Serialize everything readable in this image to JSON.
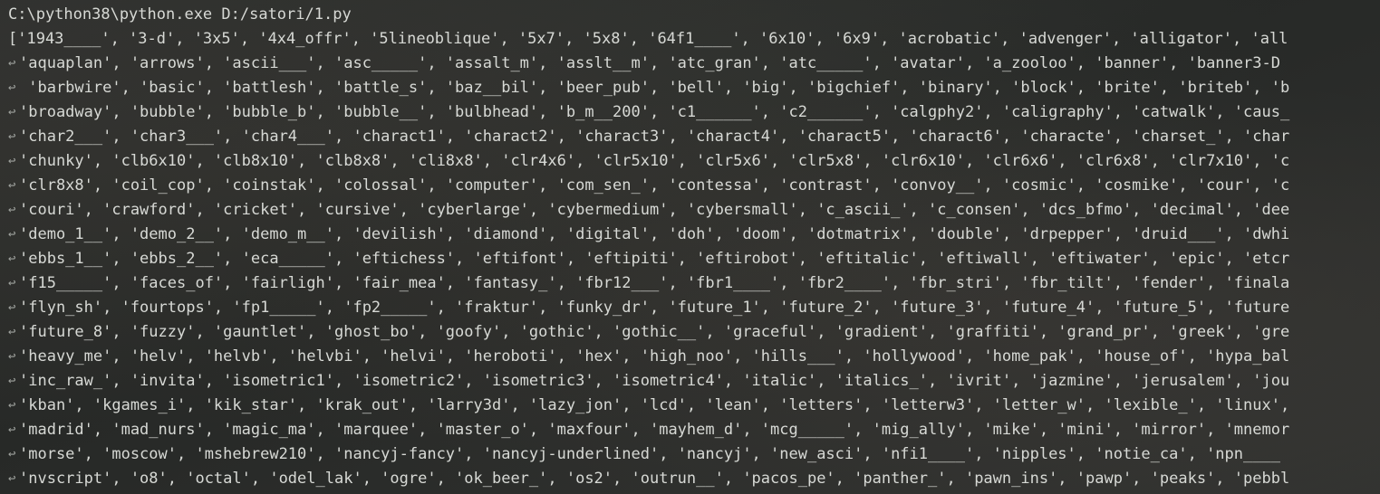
{
  "command": "C:\\python38\\python.exe D:/satori/1.py",
  "output_lines": [
    "['1943____', '3-d', '3x5', '4x4_offr', '5lineoblique', '5x7', '5x8', '64f1____', '6x10', '6x9', 'acrobatic', 'advenger', 'alligator', 'all",
    "'aquaplan', 'arrows', 'ascii___', 'asc_____', 'assalt_m', 'asslt__m', 'atc_gran', 'atc_____', 'avatar', 'a_zooloo', 'banner', 'banner3-D",
    " 'barbwire', 'basic', 'battlesh', 'battle_s', 'baz__bil', 'beer_pub', 'bell', 'big', 'bigchief', 'binary', 'block', 'brite', 'briteb', 'b",
    "'broadway', 'bubble', 'bubble_b', 'bubble__', 'bulbhead', 'b_m__200', 'c1______', 'c2______', 'calgphy2', 'caligraphy', 'catwalk', 'caus_",
    "'char2___', 'char3___', 'char4___', 'charact1', 'charact2', 'charact3', 'charact4', 'charact5', 'charact6', 'characte', 'charset_', 'char",
    "'chunky', 'clb6x10', 'clb8x10', 'clb8x8', 'cli8x8', 'clr4x6', 'clr5x10', 'clr5x6', 'clr5x8', 'clr6x10', 'clr6x6', 'clr6x8', 'clr7x10', 'c",
    "'clr8x8', 'coil_cop', 'coinstak', 'colossal', 'computer', 'com_sen_', 'contessa', 'contrast', 'convoy__', 'cosmic', 'cosmike', 'cour', 'c",
    "'couri', 'crawford', 'cricket', 'cursive', 'cyberlarge', 'cybermedium', 'cybersmall', 'c_ascii_', 'c_consen', 'dcs_bfmo', 'decimal', 'dee",
    "'demo_1__', 'demo_2__', 'demo_m__', 'devilish', 'diamond', 'digital', 'doh', 'doom', 'dotmatrix', 'double', 'drpepper', 'druid___', 'dwhi",
    "'ebbs_1__', 'ebbs_2__', 'eca_____', 'eftichess', 'eftifont', 'eftipiti', 'eftirobot', 'eftitalic', 'eftiwall', 'eftiwater', 'epic', 'etcr",
    "'f15_____', 'faces_of', 'fairligh', 'fair_mea', 'fantasy_', 'fbr12___', 'fbr1____', 'fbr2____', 'fbr_stri', 'fbr_tilt', 'fender', 'finala",
    "'flyn_sh', 'fourtops', 'fp1_____', 'fp2_____', 'fraktur', 'funky_dr', 'future_1', 'future_2', 'future_3', 'future_4', 'future_5', 'future",
    "'future_8', 'fuzzy', 'gauntlet', 'ghost_bo', 'goofy', 'gothic', 'gothic__', 'graceful', 'gradient', 'graffiti', 'grand_pr', 'greek', 'gre",
    "'heavy_me', 'helv', 'helvb', 'helvbi', 'helvi', 'heroboti', 'hex', 'high_noo', 'hills___', 'hollywood', 'home_pak', 'house_of', 'hypa_bal",
    "'inc_raw_', 'invita', 'isometric1', 'isometric2', 'isometric3', 'isometric4', 'italic', 'italics_', 'ivrit', 'jazmine', 'jerusalem', 'jou",
    "'kban', 'kgames_i', 'kik_star', 'krak_out', 'larry3d', 'lazy_jon', 'lcd', 'lean', 'letters', 'letterw3', 'letter_w', 'lexible_', 'linux',",
    "'madrid', 'mad_nurs', 'magic_ma', 'marquee', 'master_o', 'maxfour', 'mayhem_d', 'mcg_____', 'mig_ally', 'mike', 'mini', 'mirror', 'mnemor",
    "'morse', 'moscow', 'mshebrew210', 'nancyj-fancy', 'nancyj-underlined', 'nancyj', 'new_asci', 'nfi1____', 'nipples', 'notie_ca', 'npn____",
    "'nvscript', 'o8', 'octal', 'odel_lak', 'ogre', 'ok_beer_', 'os2', 'outrun__', 'pacos_pe', 'panther_', 'pawn_ins', 'pawp', 'peaks', 'pebbl"
  ]
}
